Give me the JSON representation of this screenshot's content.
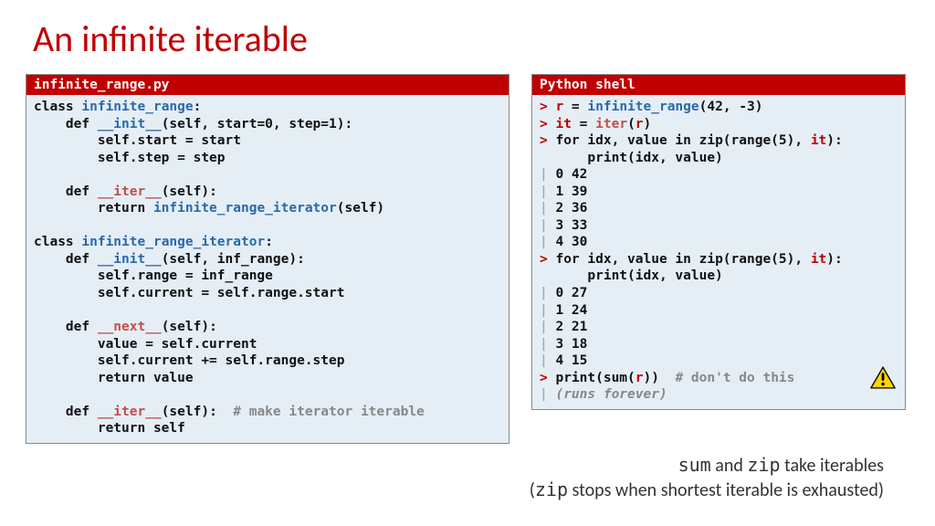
{
  "title": "An infinite iterable",
  "left": {
    "header": "infinite_range.py",
    "c1a": "class ",
    "c1b": "infinite_range",
    "c1c": ":",
    "c2a": "    def ",
    "c2b": "__init__",
    "c2c": "(self, start=0, step=1):",
    "c3": "        self.start = start",
    "c4": "        self.step = step",
    "c5a": "    def ",
    "c5b": "__iter__",
    "c5c": "(self):",
    "c6a": "        return ",
    "c6b": "infinite_range_iterator",
    "c6c": "(self)",
    "c7a": "class ",
    "c7b": "infinite_range_iterator",
    "c7c": ":",
    "c8a": "    def ",
    "c8b": "__init__",
    "c8c": "(self, inf_range):",
    "c9": "        self.range = inf_range",
    "c10": "        self.current = self.range.start",
    "c11a": "    def ",
    "c11b": "__next__",
    "c11c": "(self):",
    "c12": "        value = self.current",
    "c13": "        self.current += self.range.step",
    "c14": "        return value",
    "c15a": "    def ",
    "c15b": "__iter__",
    "c15c": "(self):  ",
    "c15d": "# make iterator iterable",
    "c16": "        return self"
  },
  "right": {
    "header": "Python shell",
    "p": "> ",
    "b": "| ",
    "r1a": "r",
    "r1b": " = ",
    "r1c": "infinite_range",
    "r1d": "(",
    "r1e": "42, -3",
    "r1f": ")",
    "r2a": "it",
    "r2b": " = ",
    "r2c": "iter",
    "r2d": "(",
    "r2e": "r",
    "r2f": ")",
    "r3a": "for idx, value in zip(range(5), ",
    "r3b": "it",
    "r3c": "):",
    "r4": "      print(idx, value)",
    "o1": "0 42",
    "o2": "1 39",
    "o3": "2 36",
    "o4": "3 33",
    "o5": "4 30",
    "o6": "0 27",
    "o7": "1 24",
    "o8": "2 21",
    "o9": "3 18",
    "o10": "4 15",
    "r5a": "print(sum(",
    "r5b": "r",
    "r5c": "))  ",
    "r5d": "# don't do this",
    "r6": "(runs forever)"
  },
  "footer": {
    "l1a": "sum",
    "l1b": " and ",
    "l1c": "zip",
    "l1d": "  take iterables",
    "l2a": "(",
    "l2b": "zip",
    "l2c": " stops when shortest iterable is exhausted)"
  }
}
